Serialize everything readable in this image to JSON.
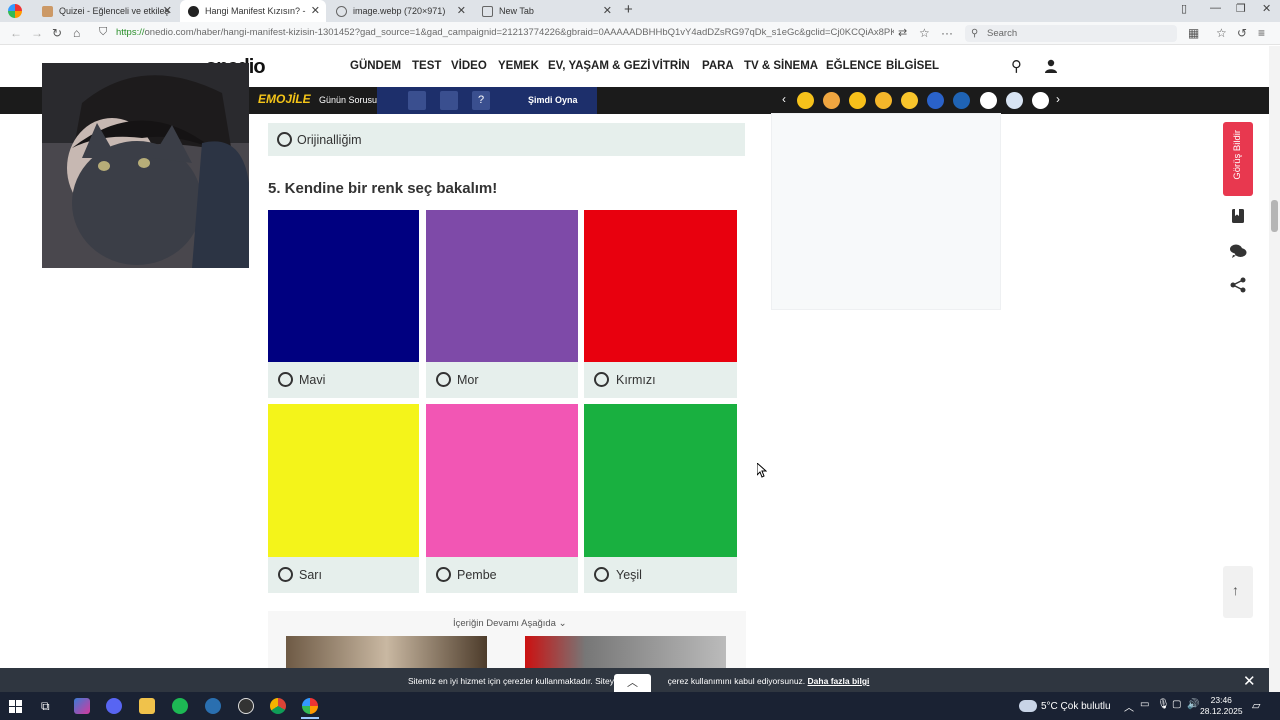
{
  "browser": {
    "tabs": [
      {
        "title": "Quizei - Eğlenceli ve etkileşimli",
        "active": false
      },
      {
        "title": "Hangi Manifest Kızısın? - One",
        "active": true
      },
      {
        "title": "image.webp (720×971)",
        "active": false
      },
      {
        "title": "New Tab",
        "active": false
      }
    ],
    "url_scheme": "https://",
    "url_rest": "onedio.com/haber/hangi-manifest-kizisin-1301452?gad_source=1&gad_campaignid=21213774226&gbraid=0AAAAADBHHbQ1vY4adDZsRG97qDk_s1eGc&gclid=Cj0KCQiAx8PKBhD",
    "search_placeholder": "Search"
  },
  "site": {
    "logo": "onedio",
    "menu": [
      "GÜNDEM",
      "TEST",
      "VİDEO",
      "YEMEK",
      "EV, YAŞAM & GEZİ",
      "VİTRİN",
      "PARA",
      "TV & SİNEMA",
      "EĞLENCE",
      "BİLGİSEL"
    ]
  },
  "emojile": {
    "brand": "EMOJİLE",
    "label": "Günün Sorusu",
    "play": "Şimdi Oyna",
    "question_mark": "?"
  },
  "quiz": {
    "prev_option": "Orijinalliğim",
    "question": "5. Kendine bir renk seç bakalım!",
    "options": [
      {
        "label": "Mavi",
        "color": "#000080"
      },
      {
        "label": "Mor",
        "color": "#7e4aa8"
      },
      {
        "label": "Kırmızı",
        "color": "#e8000e"
      },
      {
        "label": "Sarı",
        "color": "#f4f41a"
      },
      {
        "label": "Pembe",
        "color": "#f256b4"
      },
      {
        "label": "Yeşil",
        "color": "#19b040"
      }
    ]
  },
  "sidebar": {
    "feedback": "Görüş Bildir"
  },
  "continue_text": "İçeriğin Devamı Aşağıda",
  "cookie": {
    "text_before": "Sitemiz en iyi hizmet için çerezler kullanmaktadır. Siteye gi",
    "text_after": "çerez kullanımını kabul ediyorsunuz.",
    "link": "Daha fazla bilgi"
  },
  "taskbar": {
    "weather": "5°C  Çok bulutlu",
    "time": "23:46",
    "date": "28.12.2025"
  },
  "colors": {
    "accent": "#e8384f",
    "emojile_bar": "#1b1b1b",
    "option_bg": "#e6efec"
  }
}
